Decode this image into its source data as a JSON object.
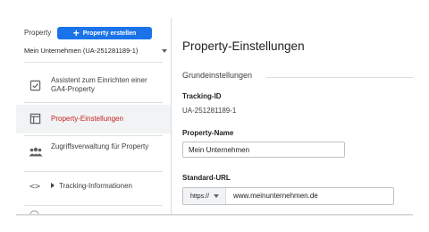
{
  "sidebar": {
    "property_label": "Property",
    "create_button": "Property erstellen",
    "account_select": "Mein Unternehmen (UA-251281189-1)",
    "items": [
      {
        "label": "Assistent zum Einrichten einer GA4-Property",
        "icon": "checklist-icon"
      },
      {
        "label": "Property-Einstellungen",
        "icon": "property-settings-icon",
        "active": true
      },
      {
        "label": "Zugriffsverwaltung für Property",
        "icon": "people-icon"
      },
      {
        "label": "Tracking-Informationen",
        "icon": "code-icon"
      }
    ]
  },
  "main": {
    "title": "Property-Einstellungen",
    "section": "Grundeinstellungen",
    "tracking_id_label": "Tracking-ID",
    "tracking_id_value": "UA-251281189-1",
    "property_name_label": "Property-Name",
    "property_name_value": "Mein Unternehmen",
    "standard_url_label": "Standard-URL",
    "protocol": "https://",
    "url_value": "www.meinunternehmen.de"
  },
  "colors": {
    "accent": "#1a73e8",
    "active_text": "#c5221f",
    "active_bg": "#f1f3f4"
  }
}
